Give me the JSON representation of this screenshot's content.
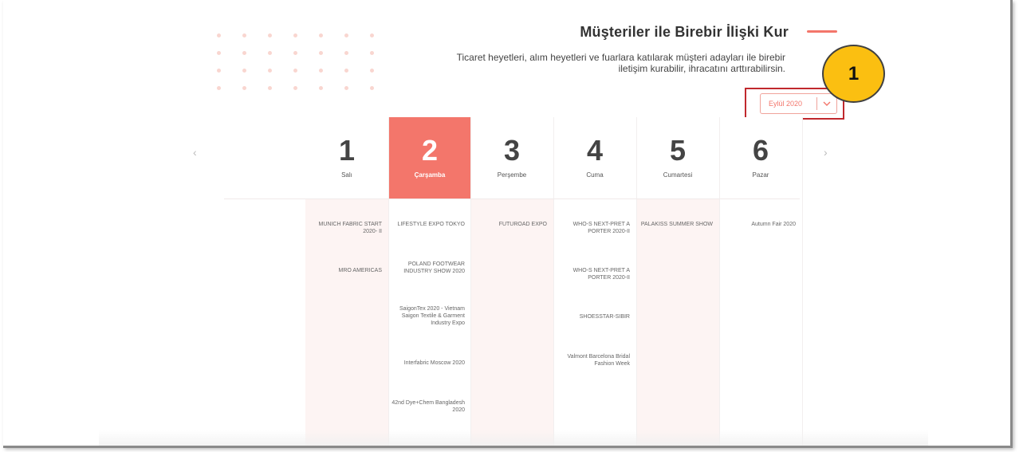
{
  "header": {
    "title": "Müşteriler ile Birebir İlişki Kur",
    "subtitle": "Ticaret heyetleri, alım heyetleri ve fuarlara katılarak müşteri adayları ile birebir iletişim kurabilir, ihracatını arttırabilirsin."
  },
  "month_select": {
    "value": "Eylül 2020",
    "icon": "chevron-down-icon"
  },
  "step_badge": {
    "label": "1",
    "color": "#fbbf11"
  },
  "nav": {
    "prev_icon": "‹",
    "next_icon": "›"
  },
  "accent_color": "#f3766b",
  "days": [
    {
      "number": "1",
      "name": "Salı",
      "events": [
        "MUNICH FABRIC START 2020- II",
        "MRO AMERICAS"
      ]
    },
    {
      "number": "2",
      "name": "Çarşamba",
      "events": [
        "LIFESTYLE EXPO TOKYO",
        "POLAND FOOTWEAR INDUSTRY SHOW 2020",
        "SaigonTex 2020 - Vietnam Saigon Textile & Garment Industry Expo",
        "Interfabric Moscow 2020",
        "42nd Dye+Chem Bangladesh 2020"
      ]
    },
    {
      "number": "3",
      "name": "Perşembe",
      "events": [
        "FUTUROAD EXPO"
      ]
    },
    {
      "number": "4",
      "name": "Cuma",
      "events": [
        "WHO-S NEXT-PRET A PORTER 2020-II",
        "WHO-S NEXT-PRET A PORTER 2020-II",
        "SHOESSTAR-SIBIR",
        "Valmont Barcelona Bridal Fashion Week"
      ]
    },
    {
      "number": "5",
      "name": "Cumartesi",
      "events": [
        "PALAKISS SUMMER SHOW"
      ]
    },
    {
      "number": "6",
      "name": "Pazar",
      "events": [
        "Autumn Fair 2020"
      ]
    }
  ]
}
